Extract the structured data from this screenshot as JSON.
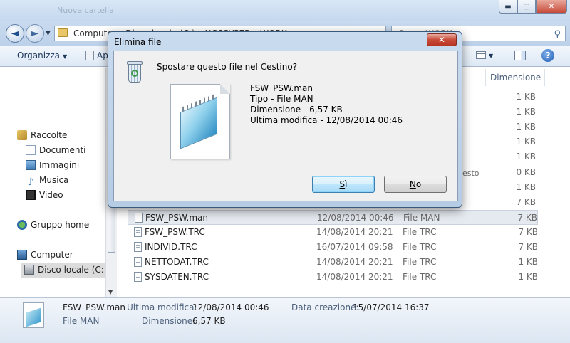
{
  "window": {
    "ghost_title": "Nuova cartella",
    "buttons": {
      "minimize": "▬",
      "maximize": "▢",
      "close": "✕"
    }
  },
  "address": {
    "path": "Computer ▸ Disco locale (C:) ▸ NGSSYPER ▸ WORK",
    "search_placeholder": "Cerca WORK"
  },
  "toolbar": {
    "organize_label": "Organizza",
    "second_label": "Ap",
    "view_icon": "views-icon",
    "help_icon": "?"
  },
  "sidebar": {
    "libraries": "Raccolte",
    "documents": "Documenti",
    "images": "Immagini",
    "music": "Musica",
    "video": "Video",
    "homegroup": "Gruppo home",
    "computer": "Computer",
    "local_disk": "Disco locale (C:)"
  },
  "filelist": {
    "size_header": "Dimensione",
    "hidden_sizes": [
      "1 KB",
      "1 KB",
      "1 KB",
      "1 KB",
      "1 KB",
      "0 KB",
      "1 KB",
      "7 KB"
    ],
    "hidden_fragment": "esto",
    "rows": [
      {
        "name": "FSW_PSW.man",
        "date": "12/08/2014 00:46",
        "type": "File MAN",
        "size": "7 KB"
      },
      {
        "name": "FSW_PSW.TRC",
        "date": "14/08/2014 20:21",
        "type": "File TRC",
        "size": "7 KB"
      },
      {
        "name": "INDIVID.TRC",
        "date": "16/07/2014 09:58",
        "type": "File TRC",
        "size": "7 KB"
      },
      {
        "name": "NETTODAT.TRC",
        "date": "14/08/2014 20:21",
        "type": "File TRC",
        "size": "1 KB"
      },
      {
        "name": "SYSDATEN.TRC",
        "date": "14/08/2014 20:21",
        "type": "File TRC",
        "size": "1 KB"
      }
    ]
  },
  "details": {
    "name": "FSW_PSW.man",
    "type": "File MAN",
    "modified_label": "Ultima modifica:",
    "modified_value": "12/08/2014 00:46",
    "size_label": "Dimensione:",
    "size_value": "6,57 KB",
    "created_label": "Data creazione:",
    "created_value": "15/07/2014 16:37"
  },
  "dialog": {
    "title": "Elimina file",
    "close": "✕",
    "question": "Spostare questo file nel Cestino?",
    "file_name": "FSW_PSW.man",
    "file_type": "Tipo - File MAN",
    "file_size": "Dimensione - 6,57 KB",
    "file_modified": "Ultima modifica - 12/08/2014 00:46",
    "yes_mnemonic": "S",
    "yes_rest": "ì",
    "no_mnemonic": "N",
    "no_rest": "o"
  }
}
